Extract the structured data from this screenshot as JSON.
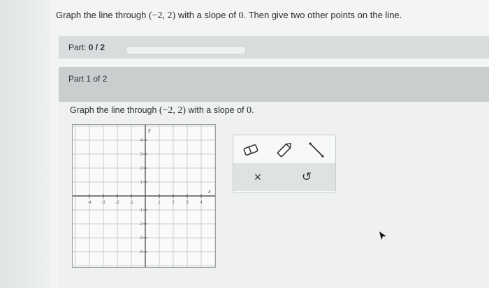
{
  "question": {
    "prefix": "Graph the line through",
    "point": "(−2, 2)",
    "middle": "with a slope of",
    "slope": "0",
    "suffix": ". Then give two other points on the line."
  },
  "progress": {
    "label": "Part:",
    "value": "0 / 2",
    "fraction": 0
  },
  "part_header": "Part 1 of 2",
  "prompt": {
    "prefix": "Graph the line through",
    "point": "(−2, 2)",
    "middle": "with a slope of",
    "slope": "0",
    "suffix": "."
  },
  "graph": {
    "y_axis_label": "y",
    "x_axis_label": "x",
    "x_ticks": [
      "-4",
      "-3",
      "-2",
      "-1",
      "1",
      "2",
      "3",
      "4"
    ],
    "y_ticks": [
      "4",
      "3",
      "2",
      "1",
      "-1",
      "-2",
      "-3",
      "-4"
    ]
  },
  "toolbox": {
    "tools": [
      "eraser-icon",
      "pencil-icon",
      "line-tool-icon"
    ],
    "clear_symbol": "×",
    "undo_symbol": "↺"
  },
  "colors": {
    "panel": "#f3f5f4",
    "bar": "#d7dcdc",
    "grid": "#c9cccc",
    "axis": "#555555"
  }
}
